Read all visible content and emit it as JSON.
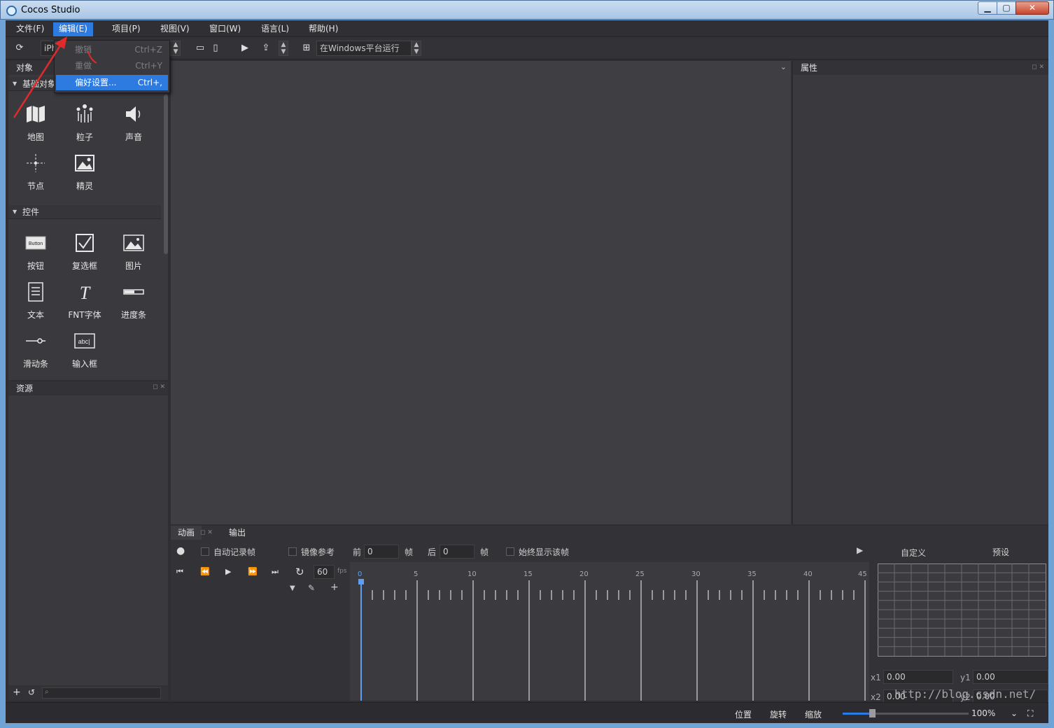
{
  "window": {
    "title": "Cocos Studio",
    "min": "▁",
    "max": "▢",
    "close": "✕"
  },
  "menubar": [
    {
      "label": "文件(F)"
    },
    {
      "label": "编辑(E)"
    },
    {
      "label": "项目(P)"
    },
    {
      "label": "视图(V)"
    },
    {
      "label": "窗口(W)"
    },
    {
      "label": "语言(L)"
    },
    {
      "label": "帮助(H)"
    }
  ],
  "toolbar": {
    "device": "iPh",
    "run_target": "在Windows平台运行"
  },
  "edit_menu": [
    {
      "label": "撤销",
      "shortcut": "Ctrl+Z",
      "enabled": false
    },
    {
      "label": "重做",
      "shortcut": "Ctrl+Y",
      "enabled": false
    },
    {
      "label": "偏好设置...",
      "shortcut": "Ctrl+,",
      "enabled": true
    }
  ],
  "objects_panel": {
    "title": "对象",
    "basic_section": "基础对象",
    "basic_items": [
      {
        "label": "地图",
        "icon": "map-icon"
      },
      {
        "label": "粒子",
        "icon": "particle-icon"
      },
      {
        "label": "声音",
        "icon": "speaker-icon"
      },
      {
        "label": "节点",
        "icon": "node-icon"
      },
      {
        "label": "精灵",
        "icon": "sprite-icon"
      }
    ],
    "controls_section": "控件",
    "control_items": [
      {
        "label": "按钮",
        "icon": "button-icon"
      },
      {
        "label": "复选框",
        "icon": "checkbox-icon"
      },
      {
        "label": "图片",
        "icon": "image-icon"
      },
      {
        "label": "文本",
        "icon": "text-icon"
      },
      {
        "label": "FNT字体",
        "icon": "font-icon"
      },
      {
        "label": "进度条",
        "icon": "progress-icon"
      },
      {
        "label": "滑动条",
        "icon": "slider-icon"
      },
      {
        "label": "输入框",
        "icon": "textfield-icon"
      }
    ]
  },
  "resources_panel": {
    "title": "资源"
  },
  "properties_panel": {
    "title": "属性"
  },
  "animation": {
    "tabs": [
      "动画",
      "输出"
    ],
    "auto_record": "自动记录帧",
    "mirror_ref": "镜像参考",
    "before_label": "前",
    "before_value": "0",
    "frame_unit": "帧",
    "after_label": "后",
    "after_value": "0",
    "always_show": "始终显示该帧",
    "fps_value": "60",
    "fps_unit": "fps",
    "ruler": [
      "0",
      "5",
      "10",
      "15",
      "20",
      "25",
      "30",
      "35",
      "40",
      "45"
    ],
    "custom_label": "自定义",
    "preset_label": "预设",
    "x1": "0.00",
    "y1": "0.00",
    "x2": "0.00",
    "y2": "0.00"
  },
  "statusbar": {
    "position": "位置",
    "rotate": "旋转",
    "scale": "缩放",
    "zoom": "100%"
  },
  "watermark": "http://blog.csdn.net/"
}
